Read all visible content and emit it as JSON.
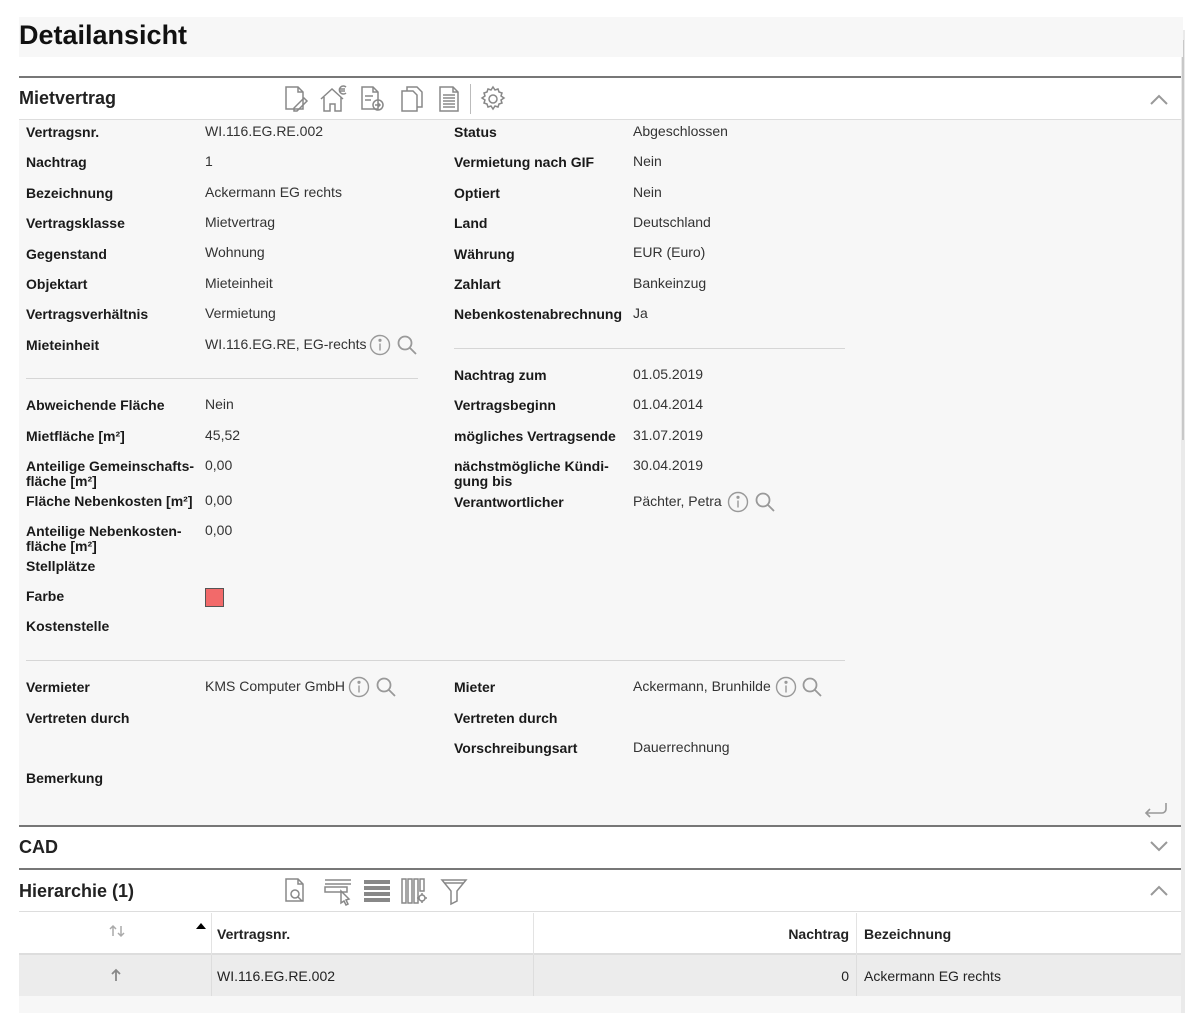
{
  "page": {
    "title": "Detailansicht"
  },
  "mietvertrag": {
    "title": "Mietvertrag",
    "toolbar_icons": [
      "edit-document-icon",
      "home-euro-icon",
      "document-export-icon",
      "copy-icon",
      "document-text-icon",
      "settings-gear-icon"
    ],
    "left_fields": [
      {
        "label": "Vertragsnr.",
        "value": "WI.116.EG.RE.002"
      },
      {
        "label": "Nachtrag",
        "value": "1"
      },
      {
        "label": "Bezeichnung",
        "value": "Ackermann EG rechts"
      },
      {
        "label": "Vertragsklasse",
        "value": "Mietvertrag"
      },
      {
        "label": "Gegenstand",
        "value": "Wohnung"
      },
      {
        "label": "Objektart",
        "value": "Mieteinheit"
      },
      {
        "label": "Vertragsverhältnis",
        "value": "Vermietung"
      },
      {
        "label": "Mieteinheit",
        "value": "WI.116.EG.RE, EG-rechts"
      }
    ],
    "right_fields": [
      {
        "label": "Status",
        "value": "Abgeschlossen"
      },
      {
        "label": "Vermietung nach GIF",
        "value": "Nein"
      },
      {
        "label": "Optiert",
        "value": "Nein"
      },
      {
        "label": "Land",
        "value": "Deutschland"
      },
      {
        "label": "Währung",
        "value": "EUR (Euro)"
      },
      {
        "label": "Zahlart",
        "value": "Bankeinzug"
      },
      {
        "label": "Nebenkostenabrechnung",
        "value": "Ja"
      }
    ],
    "area_fields": [
      {
        "label": "Abweichende Fläche",
        "value": "Nein"
      },
      {
        "label": "Mietfläche [m²]",
        "value": "45,52"
      },
      {
        "label": "Anteilige Gemeinschafts-\nfläche [m²]",
        "value": "0,00"
      },
      {
        "label": "Fläche Nebenkosten [m²]",
        "value": "0,00"
      },
      {
        "label": "Anteilige Nebenkosten-\nfläche [m²]",
        "value": "0,00"
      },
      {
        "label": "Stellplätze",
        "value": ""
      },
      {
        "label": "Farbe",
        "value": ""
      },
      {
        "label": "Kostenstelle",
        "value": ""
      }
    ],
    "farbe_color": "#f26a6a",
    "date_fields": [
      {
        "label": "Nachtrag zum",
        "value": "01.05.2019"
      },
      {
        "label": "Vertragsbeginn",
        "value": "01.04.2014"
      },
      {
        "label": "mögliches Vertragsende",
        "value": "31.07.2019"
      },
      {
        "label": "nächstmögliche Kündi-\ngung bis",
        "value": "30.04.2019"
      },
      {
        "label": "Verantwortlicher",
        "value": "Pächter, Petra"
      }
    ],
    "party_left": [
      {
        "label": "Vermieter",
        "value": "KMS Computer GmbH"
      },
      {
        "label": "Vertreten durch",
        "value": ""
      },
      {
        "label": "Bemerkung",
        "value": ""
      }
    ],
    "party_right": [
      {
        "label": "Mieter",
        "value": "Ackermann, Brunhilde"
      },
      {
        "label": "Vertreten durch",
        "value": ""
      },
      {
        "label": "Vorschreibungsart",
        "value": "Dauerrechnung"
      }
    ]
  },
  "cad": {
    "title": "CAD"
  },
  "hierarchie": {
    "title": "Hierarchie (1)",
    "toolbar_icons": [
      "document-search-icon",
      "select-cursor-icon",
      "list-lines-icon",
      "columns-settings-icon",
      "filter-icon"
    ],
    "columns": [
      "Vertragsnr.",
      "Nachtrag",
      "Bezeichnung"
    ],
    "rows": [
      {
        "vertragsnr": "WI.116.EG.RE.002",
        "nachtrag": "0",
        "bezeichnung": "Ackermann EG rechts"
      }
    ]
  }
}
